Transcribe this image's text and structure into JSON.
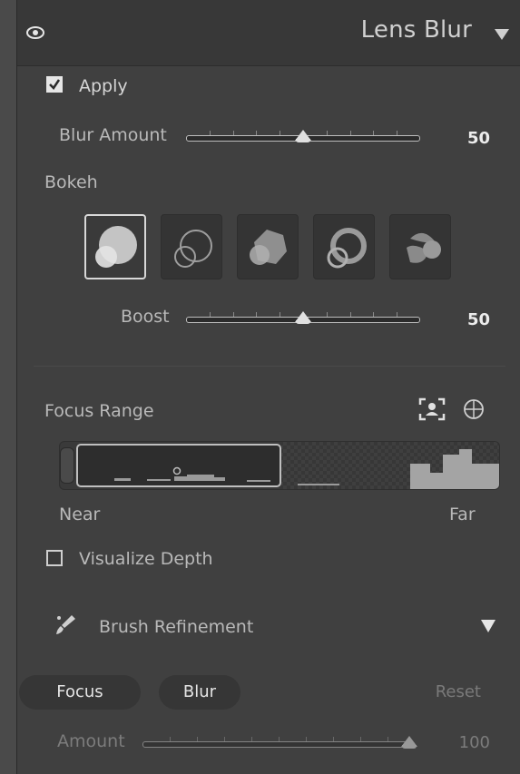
{
  "panel": {
    "title": "Lens Blur",
    "icons": {
      "visibility": "eye-icon",
      "collapse": "triangle-down-icon"
    }
  },
  "apply": {
    "label": "Apply",
    "checked": true
  },
  "blur_amount": {
    "label": "Blur Amount",
    "value": "50"
  },
  "bokeh": {
    "label": "Bokeh",
    "shapes": [
      "circle",
      "ring",
      "blade",
      "cat-eye",
      "soap-bubble"
    ],
    "selected": 0,
    "boost": {
      "label": "Boost",
      "value": "50"
    }
  },
  "focus_range": {
    "label": "Focus Range",
    "icons": [
      "subject-focus-icon",
      "crosshair-target-icon"
    ],
    "near_label": "Near",
    "far_label": "Far"
  },
  "visualize_depth": {
    "label": "Visualize Depth",
    "checked": false
  },
  "brush_refinement": {
    "label": "Brush Refinement",
    "icons": {
      "brush": "brush-icon",
      "expand": "triangle-down-icon"
    },
    "focus_label": "Focus",
    "blur_label": "Blur",
    "reset_label": "Reset",
    "amount": {
      "label": "Amount",
      "value": "100"
    }
  },
  "colors": {
    "panel_bg": "#404040",
    "header_bg": "#383838",
    "text": "#d8d8d8",
    "disabled_text": "#7a7a7a"
  }
}
